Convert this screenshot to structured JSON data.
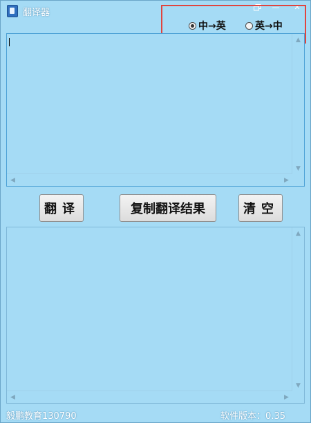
{
  "window": {
    "title": "翻译器",
    "restore_icon": "restore-icon",
    "minimize_glyph": "—",
    "close_glyph": "✕"
  },
  "direction": {
    "options": [
      {
        "label": "中→英",
        "checked": true
      },
      {
        "label": "英→中",
        "checked": false
      }
    ]
  },
  "source": {
    "value": ""
  },
  "buttons": {
    "translate": "翻译",
    "copy": "复制翻译结果",
    "clear": "清空"
  },
  "result": {
    "value": ""
  },
  "status": {
    "left": "毅鹏教育130790",
    "right": "软件版本：0.35"
  },
  "colors": {
    "background": "#a5dbf5",
    "highlight": "#e0443e"
  }
}
